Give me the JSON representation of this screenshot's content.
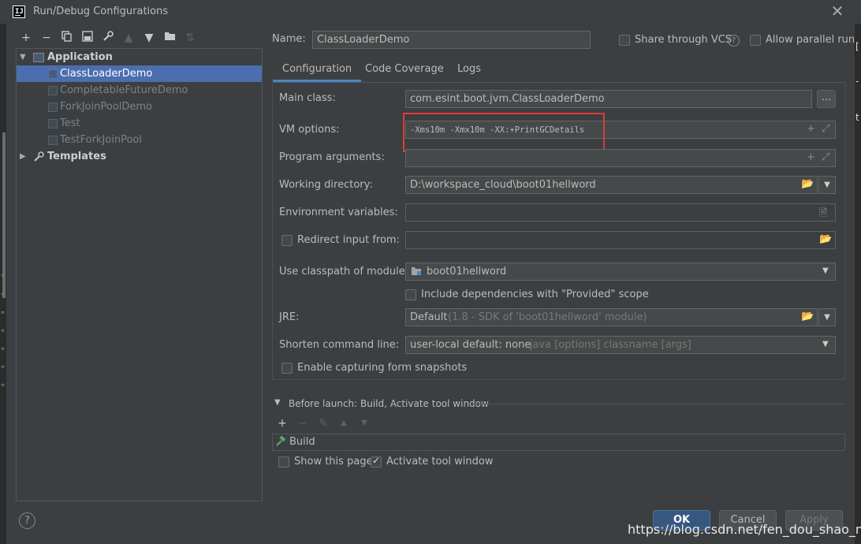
{
  "window": {
    "title": "Run/Debug Configurations",
    "app_icon": "IJ"
  },
  "toolbar": [
    "+",
    "−",
    "copy",
    "save",
    "wrench",
    "up",
    "down",
    "folder",
    "sort"
  ],
  "tree": {
    "application_label": "Application",
    "items": [
      "ClassLoaderDemo",
      "CompletableFutureDemo",
      "ForkJoinPoolDemo",
      "Test",
      "TestForkJoinPool"
    ],
    "templates_label": "Templates"
  },
  "header": {
    "name_label": "Name:",
    "name_value": "ClassLoaderDemo",
    "share_label": "Share through VCS",
    "help": "?",
    "parallel_label": "Allow parallel run"
  },
  "tabs": [
    "Configuration",
    "Code Coverage",
    "Logs"
  ],
  "form": {
    "main_class_label": "Main class:",
    "main_class_value": "com.esint.boot.jvm.ClassLoaderDemo",
    "browse": "...",
    "vm_options_label": "VM options:",
    "vm_options_value": "-Xms10m -Xmx10m -XX:+PrintGCDetails",
    "program_args_label": "Program arguments:",
    "working_dir_label": "Working directory:",
    "working_dir_value": "D:\\workspace_cloud\\boot01hellword",
    "env_vars_label": "Environment variables:",
    "redirect_label": "Redirect input from:",
    "classpath_label": "Use classpath of module:",
    "classpath_value": "boot01hellword",
    "include_deps_label": "Include dependencies with \"Provided\" scope",
    "jre_label": "JRE:",
    "jre_value": "Default",
    "jre_hint": "(1.8 - SDK of 'boot01hellword' module)",
    "shorten_label": "Shorten command line:",
    "shorten_value": "user-local default: none",
    "shorten_hint": "- java [options] classname [args]",
    "snapshots_label": "Enable capturing form snapshots"
  },
  "before_launch": {
    "title": "Before launch: Build, Activate tool window",
    "task": "Build",
    "show_page_label": "Show this page",
    "activate_label": "Activate tool window"
  },
  "buttons": {
    "ok": "OK",
    "cancel": "Cancel",
    "apply": "Apply",
    "help": "?"
  },
  "watermark": "https://blog.csdn.net/fen_dou_shao_nian",
  "colors": {
    "background": "#3c3f41",
    "selection": "#4b6eaf",
    "highlight": "#e03a3a",
    "accent": "#4a88c7"
  }
}
